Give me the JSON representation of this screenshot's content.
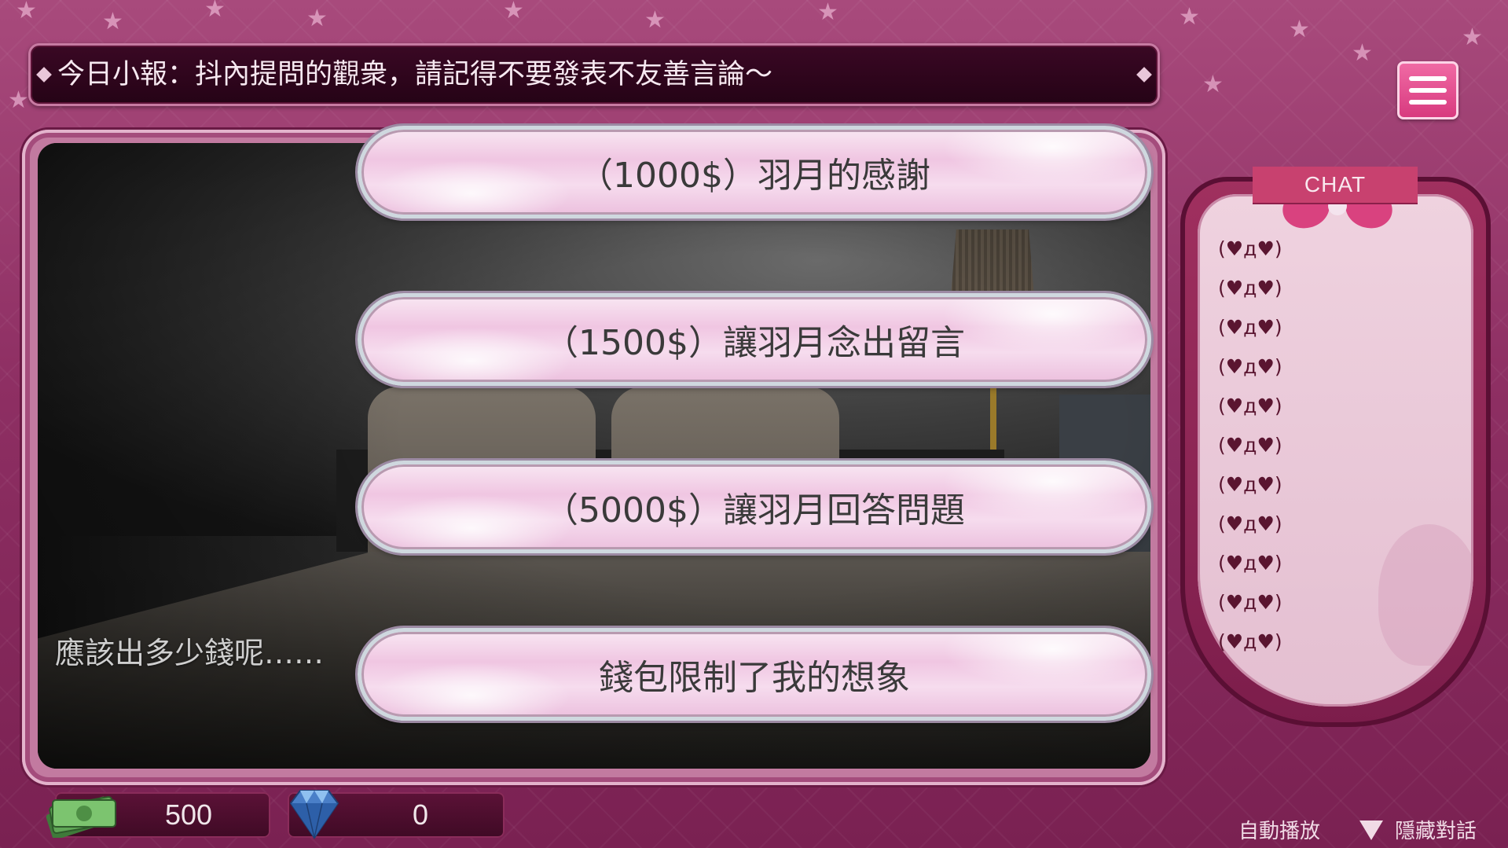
{
  "ticker": {
    "text": "今日小報：抖內提問的觀衆，請記得不要發表不友善言論～"
  },
  "scene": {
    "hint": "應該出多少錢呢……"
  },
  "choices": [
    {
      "label": "（1000$）羽月的感謝"
    },
    {
      "label": "（1500$）讓羽月念出留言"
    },
    {
      "label": "（5000$）讓羽月回答問題"
    },
    {
      "label": "錢包限制了我的想象"
    }
  ],
  "chat": {
    "title": "CHAT",
    "messages": [
      "(♥д♥)",
      "(♥д♥)",
      "(♥д♥)",
      "(♥д♥)",
      "(♥д♥)",
      "(♥д♥)",
      "(♥д♥)",
      "(♥д♥)",
      "(♥д♥)",
      "(♥д♥)",
      "(♥д♥)"
    ]
  },
  "currency": {
    "money": "500",
    "gems": "0"
  },
  "controls": {
    "auto_play": "自動播放",
    "hide_dialog": "隱藏對話"
  },
  "icons": {
    "menu": "menu-icon",
    "money": "money-stack-icon",
    "gem": "diamond-icon",
    "hide": "triangle-down-icon"
  },
  "colors": {
    "accent": "#d83a7f",
    "background": "#8e2f63",
    "ticker_bg": "#250316"
  }
}
